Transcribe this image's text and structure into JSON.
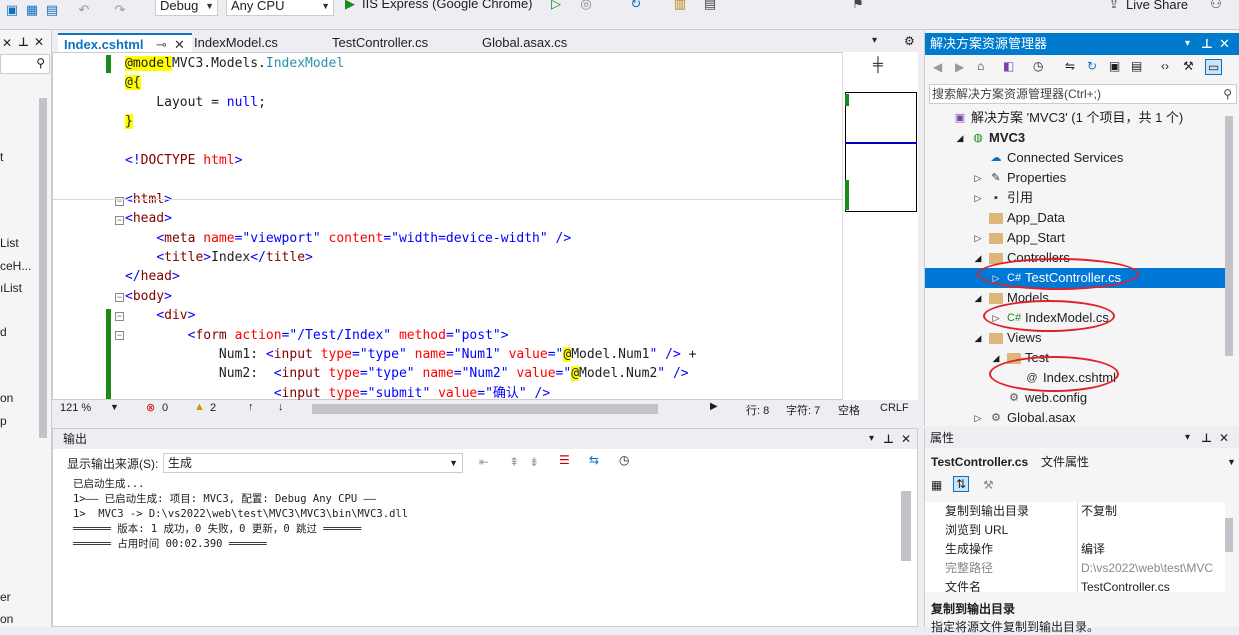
{
  "toolbar": {
    "config": "Debug",
    "platform": "Any CPU",
    "run_target": "IIS Express (Google Chrome)",
    "live_share": "Live Share"
  },
  "left_panel": {
    "items": [
      "t",
      "List",
      "ceH...",
      "ıList",
      "d",
      "on",
      "p",
      "er",
      "on"
    ]
  },
  "tabs": [
    {
      "label": "Index.cshtml",
      "active": true
    },
    {
      "label": "IndexModel.cs"
    },
    {
      "label": "TestController.cs"
    },
    {
      "label": "Global.asax.cs"
    }
  ],
  "editor": {
    "lines": [
      {
        "tokens": [
          [
            "razor",
            "@model"
          ],
          [
            "",
            "MVC3.Models."
          ],
          [
            "type",
            "IndexModel"
          ]
        ]
      },
      {
        "tokens": [
          [
            "razor",
            "@{"
          ]
        ]
      },
      {
        "tokens": [
          [
            "",
            "    Layout = "
          ],
          [
            "kw",
            "null"
          ],
          [
            "",
            ";"
          ]
        ]
      },
      {
        "tokens": [
          [
            "razor",
            "}"
          ]
        ]
      },
      {
        "tokens": []
      },
      {
        "tokens": [
          [
            "kw",
            "<!"
          ],
          [
            "tag",
            "DOCTYPE "
          ],
          [
            "attr",
            "html"
          ],
          [
            "kw",
            ">"
          ]
        ]
      },
      {
        "tokens": []
      },
      {
        "tokens": [
          [
            "kw",
            "<"
          ],
          [
            "tag",
            "html"
          ],
          [
            "kw",
            ">"
          ]
        ]
      },
      {
        "tokens": [
          [
            "kw",
            "<"
          ],
          [
            "tag",
            "head"
          ],
          [
            "kw",
            ">"
          ]
        ]
      },
      {
        "tokens": [
          [
            "",
            "    "
          ],
          [
            "kw",
            "<"
          ],
          [
            "tag",
            "meta "
          ],
          [
            "attr",
            "name"
          ],
          [
            "kw",
            "=\"viewport\" "
          ],
          [
            "attr",
            "content"
          ],
          [
            "kw",
            "=\"width=device-width\" />"
          ]
        ]
      },
      {
        "tokens": [
          [
            "",
            "    "
          ],
          [
            "kw",
            "<"
          ],
          [
            "tag",
            "title"
          ],
          [
            "kw",
            ">"
          ],
          [
            "",
            "Index"
          ],
          [
            "kw",
            "</"
          ],
          [
            "tag",
            "title"
          ],
          [
            "kw",
            ">"
          ]
        ]
      },
      {
        "tokens": [
          [
            "kw",
            "</"
          ],
          [
            "tag",
            "head"
          ],
          [
            "kw",
            ">"
          ]
        ]
      },
      {
        "tokens": [
          [
            "kw",
            "<"
          ],
          [
            "tag",
            "body"
          ],
          [
            "kw",
            ">"
          ]
        ]
      },
      {
        "tokens": [
          [
            "",
            "    "
          ],
          [
            "kw",
            "<"
          ],
          [
            "tag",
            "div"
          ],
          [
            "kw",
            ">"
          ]
        ]
      },
      {
        "tokens": [
          [
            "",
            "        "
          ],
          [
            "kw",
            "<"
          ],
          [
            "tag",
            "form "
          ],
          [
            "attr",
            "action"
          ],
          [
            "kw",
            "=\"/Test/Index\" "
          ],
          [
            "attr",
            "method"
          ],
          [
            "kw",
            "=\"post\">"
          ]
        ]
      },
      {
        "tokens": [
          [
            "",
            "            Num1: "
          ],
          [
            "kw",
            "<"
          ],
          [
            "tag",
            "input "
          ],
          [
            "attr",
            "type"
          ],
          [
            "kw",
            "=\"type\" "
          ],
          [
            "attr",
            "name"
          ],
          [
            "kw",
            "=\"Num1\" "
          ],
          [
            "attr",
            "value"
          ],
          [
            "kw",
            "=\""
          ],
          [
            "razor",
            "@"
          ],
          [
            "",
            "Model.Num1"
          ],
          [
            "kw",
            "\" /> "
          ],
          [
            "",
            "+"
          ]
        ]
      },
      {
        "tokens": [
          [
            "",
            "            Num2:  "
          ],
          [
            "kw",
            "<"
          ],
          [
            "tag",
            "input "
          ],
          [
            "attr",
            "type"
          ],
          [
            "kw",
            "=\"type\" "
          ],
          [
            "attr",
            "name"
          ],
          [
            "kw",
            "=\"Num2\" "
          ],
          [
            "attr",
            "value"
          ],
          [
            "kw",
            "=\""
          ],
          [
            "razor",
            "@"
          ],
          [
            "",
            "Model.Num2"
          ],
          [
            "kw",
            "\" />"
          ]
        ]
      },
      {
        "tokens": [
          [
            "",
            "                   "
          ],
          [
            "kw",
            "<"
          ],
          [
            "tag",
            "input "
          ],
          [
            "attr",
            "type"
          ],
          [
            "kw",
            "=\"submit\" "
          ],
          [
            "attr",
            "value"
          ],
          [
            "kw",
            "=\"确认\" />"
          ]
        ]
      }
    ]
  },
  "editor_status": {
    "zoom": "121 %",
    "errors": "0",
    "warnings": "2",
    "row": "行: 8",
    "col": "字符: 7",
    "mode": "空格",
    "eol": "CRLF"
  },
  "output": {
    "title": "输出",
    "source_label": "显示输出来源(S):",
    "source_value": "生成",
    "lines": [
      "已启动生成...",
      "1>—— 已启动生成: 项目: MVC3, 配置: Debug Any CPU ——",
      "1>  MVC3 -> D:\\vs2022\\web\\test\\MVC3\\MVC3\\bin\\MVC3.dll",
      "══════ 版本: 1 成功，0 失败，0 更新，0 跳过 ══════",
      "══════ 占用时间 00:02.390 ══════"
    ]
  },
  "solution": {
    "title": "解决方案资源管理器",
    "search_placeholder": "搜索解决方案资源管理器(Ctrl+;)",
    "tree": [
      {
        "label": "解决方案 'MVC3' (1 个项目，共 1 个)",
        "indent": 0,
        "icon": "solution"
      },
      {
        "label": "MVC3",
        "indent": 1,
        "icon": "web",
        "bold": true
      },
      {
        "label": "Connected Services",
        "indent": 2,
        "icon": "cloud"
      },
      {
        "label": "Properties",
        "indent": 2,
        "icon": "wrench"
      },
      {
        "label": "引用",
        "indent": 2,
        "icon": "ref"
      },
      {
        "label": "App_Data",
        "indent": 2,
        "icon": "folder"
      },
      {
        "label": "App_Start",
        "indent": 2,
        "icon": "folder"
      },
      {
        "label": "Controllers",
        "indent": 2,
        "icon": "folder"
      },
      {
        "label": "TestController.cs",
        "indent": 3,
        "icon": "cs",
        "selected": true
      },
      {
        "label": "Models",
        "indent": 2,
        "icon": "folder"
      },
      {
        "label": "IndexModel.cs",
        "indent": 3,
        "icon": "cs"
      },
      {
        "label": "Views",
        "indent": 2,
        "icon": "folder"
      },
      {
        "label": "Test",
        "indent": 3,
        "icon": "folder"
      },
      {
        "label": "Index.cshtml",
        "indent": 4,
        "icon": "razor"
      },
      {
        "label": "web.config",
        "indent": 3,
        "icon": "config"
      },
      {
        "label": "Global.asax",
        "indent": 2,
        "icon": "config"
      }
    ]
  },
  "properties": {
    "title": "属性",
    "object": "TestController.cs",
    "object_type": "文件属性",
    "rows": [
      [
        "复制到输出目录",
        "不复制"
      ],
      [
        "浏览到 URL",
        ""
      ],
      [
        "生成操作",
        "编译"
      ],
      [
        "完整路径",
        "D:\\vs2022\\web\\test\\MVC"
      ],
      [
        "文件名",
        "TestController.cs"
      ]
    ],
    "desc_title": "复制到输出目录",
    "desc_text": "指定将源文件复制到输出目录。"
  }
}
